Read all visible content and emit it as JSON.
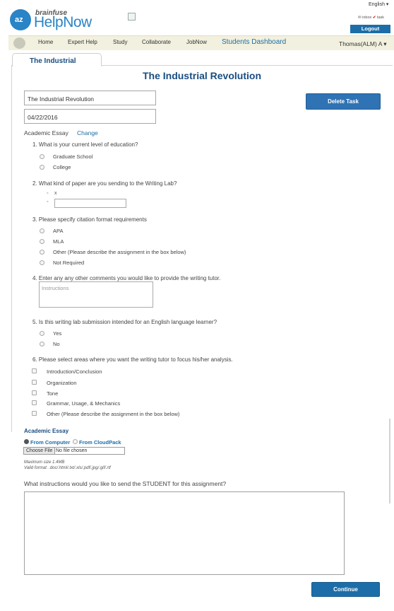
{
  "header": {
    "brand_top": "brainfuse",
    "brand_main": "HelpNow",
    "logo_text": "az",
    "language": "English ▾",
    "inbox_label": "inbox",
    "task_label": "task",
    "logout": "Logout"
  },
  "nav": {
    "items": [
      "Home",
      "Expert Help",
      "Study",
      "Collaborate",
      "JobNow"
    ],
    "dashboard": "Students Dashboard",
    "user": "Thomas(ALM) A ▾"
  },
  "tab_label": "The Industrial",
  "page_title": "The Industrial Revolution",
  "task": {
    "title_value": "The Industrial Revolution",
    "date_value": "04/22/2016",
    "delete_button": "Delete Task"
  },
  "essay": {
    "type": "Academic Essay",
    "change_link": "Change"
  },
  "questions": {
    "q1": "1. What is your current level of education?",
    "q1_options": [
      "Graduate School",
      "College"
    ],
    "q2": "2. What kind of paper are you sending to the Writing Lab?",
    "q2_bullet": "x",
    "q3": "3. Please specify citation format requirements",
    "q3_options": [
      "APA",
      "MLA",
      "Other (Please describe the assignment in the box below)",
      "Not Required"
    ],
    "q4": "4. Enter any any other comments you would like to provide the writing tutor.",
    "q4_placeholder": "Instructions",
    "q5": "5. Is this writing lab submission intended for an English language learner?",
    "q5_options": [
      "Yes",
      "No"
    ],
    "q6": "6. Please select areas where you want the writing tutor to focus his/her analysis.",
    "q6_options": [
      "Introduction/Conclusion",
      "Organization",
      "Tone",
      "Grammar, Usage, & Mechanics",
      "Other (Please describe the assignment in the box below)"
    ]
  },
  "upload": {
    "heading": "Academic Essay",
    "from_computer": "From Computer",
    "from_cloudpack": "From CloudPack",
    "choose_file": "Choose File",
    "no_file": "No file chosen",
    "max_size": "Maximum size 1.4MB",
    "valid_format": "Valid format:  .doc/.html/.txt/.xls/.pdf/.jpg/.gif/.rtf"
  },
  "student_question": "What instructions would you like to send the STUDENT for this assignment?",
  "continue_button": "Continue",
  "colors": {
    "brand_blue": "#2a84c6",
    "button_blue": "#1d6ea8",
    "title_navy": "#1a4d80",
    "nav_bg": "#f2f0de"
  }
}
